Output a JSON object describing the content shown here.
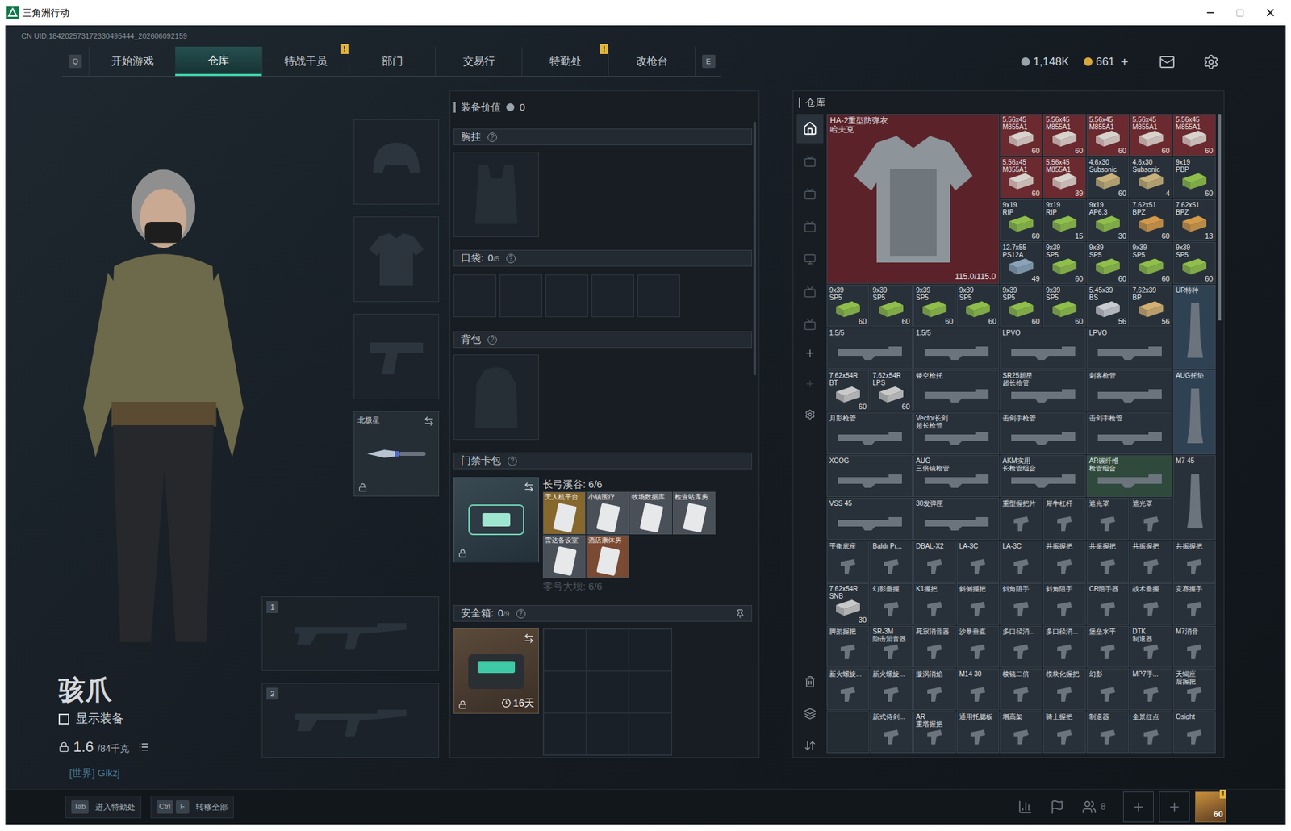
{
  "window": {
    "title": "三角洲行动",
    "uid": "CN UID:184202573172330495444_202606092159"
  },
  "nav": {
    "left_key": "Q",
    "right_key": "E",
    "tabs": [
      {
        "label": "开始游戏",
        "selected": false,
        "badge": ""
      },
      {
        "label": "仓库",
        "selected": true,
        "badge": ""
      },
      {
        "label": "特战干员",
        "selected": false,
        "badge": "!"
      },
      {
        "label": "部门",
        "selected": false,
        "badge": ""
      },
      {
        "label": "交易行",
        "selected": false,
        "badge": ""
      },
      {
        "label": "特勤处",
        "selected": false,
        "badge": "!"
      },
      {
        "label": "改枪台",
        "selected": false,
        "badge": ""
      }
    ],
    "currency": [
      {
        "value": "1,148K",
        "plus": "",
        "color": "#9aa3ab"
      },
      {
        "value": "661",
        "plus": "+",
        "color": "#d8a73a"
      }
    ]
  },
  "character": {
    "name": "骇爪",
    "show_equipment": {
      "label": "显示装备",
      "checked": false
    },
    "weight": "1.6",
    "capacity": "/84千克",
    "chat": "[世界] Gikzj"
  },
  "equipment_slots": [
    {
      "kind": "helmet",
      "label": "",
      "locked": false
    },
    {
      "kind": "armor",
      "label": "",
      "locked": false
    },
    {
      "kind": "pistol",
      "label": "",
      "locked": false
    },
    {
      "kind": "knife",
      "label": "北极星",
      "locked": true
    }
  ],
  "weapon_slots": [
    {
      "number": "1"
    },
    {
      "number": "2"
    }
  ],
  "loadout": {
    "value_label": "装备价值",
    "value": "0",
    "chest": {
      "label": "胸挂",
      "help": "?"
    },
    "pockets": {
      "label": "口袋:",
      "count": "0",
      "capacity": "/5",
      "help": "?",
      "slots": 5
    },
    "backpack": {
      "label": "背包",
      "help": "?"
    },
    "keycards": {
      "label": "门禁卡包",
      "help": "?",
      "locked": true,
      "maps": [
        {
          "name": "长弓溪谷: 6/6",
          "active": true,
          "cards": [
            {
              "name": "无人机平台",
              "color": "#86672c"
            },
            {
              "name": "小镇医疗",
              "color": "#4a5057"
            },
            {
              "name": "牧场数据库",
              "color": "#4a5057"
            },
            {
              "name": "检查站库房",
              "color": "#4a5057"
            },
            {
              "name": "雷达备设室",
              "color": "#4a5057"
            },
            {
              "name": "酒店康体房",
              "color": "#7a4a32"
            }
          ]
        },
        {
          "name": "零号大坝: 6/6",
          "active": false,
          "cards": []
        }
      ]
    },
    "safe": {
      "label": "安全箱:",
      "count": "0",
      "capacity": "/9",
      "help": "?",
      "timer": "16天",
      "locked": true,
      "cells": 9
    }
  },
  "warehouse": {
    "title": "仓库",
    "items": [
      {
        "name": "HA-2重型防弹衣\n哈夫克",
        "count": "115.0/115.0",
        "kind": "armor",
        "color": "#5b2329"
      },
      {
        "name": "5.56x45\nM855A1",
        "count": "60",
        "kind": "ammo",
        "color": "#6a2a2f",
        "box": "#d7d2cc"
      },
      {
        "name": "5.56x45\nM855A1",
        "count": "60",
        "kind": "ammo",
        "color": "#6a2a2f",
        "box": "#d7d2cc"
      },
      {
        "name": "5.56x45\nM855A1",
        "count": "60",
        "kind": "ammo",
        "color": "#6a2a2f",
        "box": "#d7d2cc"
      },
      {
        "name": "5.56x45\nM855A1",
        "count": "60",
        "kind": "ammo",
        "color": "#6a2a2f",
        "box": "#d7d2cc"
      },
      {
        "name": "5.56x45\nM855A1",
        "count": "60",
        "kind": "ammo",
        "color": "#6a2a2f",
        "box": "#d7d2cc"
      },
      {
        "name": "5.56x45\nM855A1",
        "count": "60",
        "kind": "ammo",
        "color": "#6a2a2f",
        "box": "#d7d2cc"
      },
      {
        "name": "5.56x45\nM855A1",
        "count": "39",
        "kind": "ammo",
        "color": "#6a2a2f",
        "box": "#d7d2cc"
      },
      {
        "name": "4.6x30\nSubsonic",
        "count": "60",
        "kind": "ammo",
        "color": "#28313a",
        "box": "#c8b27a"
      },
      {
        "name": "4.6x30\nSubsonic",
        "count": "4",
        "kind": "ammo",
        "color": "#28313a",
        "box": "#c8b27a"
      },
      {
        "name": "9x19\nPBP",
        "count": "60",
        "kind": "ammo",
        "color": "#28313a",
        "box": "#8fbf4a"
      },
      {
        "name": "9x19\nRIP",
        "count": "60",
        "kind": "ammo",
        "color": "#28313a",
        "box": "#8fbf4a"
      },
      {
        "name": "9x19\nRIP",
        "count": "15",
        "kind": "ammo",
        "color": "#28313a",
        "box": "#8fbf4a"
      },
      {
        "name": "9x19\nAP6.3",
        "count": "30",
        "kind": "ammo",
        "color": "#28313a",
        "box": "#8fbf4a"
      },
      {
        "name": "7.62x51\nBPZ",
        "count": "60",
        "kind": "ammo",
        "color": "#28313a",
        "box": "#d39a4a"
      },
      {
        "name": "7.62x51\nBPZ",
        "count": "13",
        "kind": "ammo",
        "color": "#28313a",
        "box": "#d39a4a"
      },
      {
        "name": "12.7x55\nPS12A",
        "count": "49",
        "kind": "ammo",
        "color": "#28313a",
        "box": "#8aa3b8"
      },
      {
        "name": "9x39\nSP5",
        "count": "60",
        "kind": "ammo",
        "color": "#28313a",
        "box": "#8fbf4a"
      },
      {
        "name": "9x39\nSP5",
        "count": "60",
        "kind": "ammo",
        "color": "#28313a",
        "box": "#8fbf4a"
      },
      {
        "name": "9x39\nSP5",
        "count": "60",
        "kind": "ammo",
        "color": "#28313a",
        "box": "#8fbf4a"
      },
      {
        "name": "9x39\nSP5",
        "count": "60",
        "kind": "ammo",
        "color": "#28313a",
        "box": "#8fbf4a"
      },
      {
        "name": "9x39\nSP5",
        "count": "60",
        "kind": "ammo",
        "color": "#28313a",
        "box": "#8fbf4a"
      },
      {
        "name": "9x39\nSP5",
        "count": "60",
        "kind": "ammo",
        "color": "#28313a",
        "box": "#8fbf4a"
      },
      {
        "name": "9x39\nSP5",
        "count": "60",
        "kind": "ammo",
        "color": "#28313a",
        "box": "#8fbf4a"
      },
      {
        "name": "9x39\nSP5",
        "count": "60",
        "kind": "ammo",
        "color": "#28313a",
        "box": "#8fbf4a"
      },
      {
        "name": "9x39\nSP5",
        "count": "60",
        "kind": "ammo",
        "color": "#28313a",
        "box": "#8fbf4a"
      },
      {
        "name": "9x39\nSP5",
        "count": "60",
        "kind": "ammo",
        "color": "#28313a",
        "box": "#8fbf4a"
      },
      {
        "name": "5.45x39\nBS",
        "count": "56",
        "kind": "ammo",
        "color": "#28313a",
        "box": "#c9ccd0"
      },
      {
        "name": "7.62x39\nBP",
        "count": "56",
        "kind": "ammo",
        "color": "#28313a",
        "box": "#d4b072"
      },
      {
        "name": "UR特种",
        "count": "",
        "kind": "tall",
        "color": "#2f4254"
      },
      {
        "name": "1.5/5",
        "count": "",
        "kind": "wide",
        "color": "#28313a"
      },
      {
        "name": "1.5/5",
        "count": "",
        "kind": "wide",
        "color": "#28313a"
      },
      {
        "name": "LPVO",
        "count": "",
        "kind": "wide",
        "color": "#28313a"
      },
      {
        "name": "LPVO",
        "count": "",
        "kind": "wide",
        "color": "#28313a"
      },
      {
        "name": "7.62x54R\nBT",
        "count": "60",
        "kind": "ammo",
        "color": "#28313a",
        "box": "#c8c8c8"
      },
      {
        "name": "7.62x54R\nLPS",
        "count": "60",
        "kind": "ammo",
        "color": "#28313a",
        "box": "#c8c8c8"
      },
      {
        "name": "镂空枪托",
        "count": "",
        "kind": "wide",
        "color": "#28313a"
      },
      {
        "name": "SR25新星\n超长枪管",
        "count": "",
        "kind": "wide",
        "color": "#28313a"
      },
      {
        "name": "刺客枪管",
        "count": "",
        "kind": "wide",
        "color": "#28313a"
      },
      {
        "name": "AUG托垫",
        "count": "",
        "kind": "tall",
        "color": "#2f4254"
      },
      {
        "name": "月影枪管",
        "count": "",
        "kind": "wide",
        "color": "#28313a"
      },
      {
        "name": "Vector长剑\n超长枪管",
        "count": "",
        "kind": "wide",
        "color": "#28313a"
      },
      {
        "name": "击剑手枪管",
        "count": "",
        "kind": "wide",
        "color": "#28313a"
      },
      {
        "name": "击剑手枪管",
        "count": "",
        "kind": "wide",
        "color": "#28313a"
      },
      {
        "name": "XCOG",
        "count": "",
        "kind": "wide",
        "color": "#28313a"
      },
      {
        "name": "AUG\n三倍镜枪管",
        "count": "",
        "kind": "wide",
        "color": "#28313a"
      },
      {
        "name": "AKM实用\n长枪管组合",
        "count": "",
        "kind": "wide",
        "color": "#28313a"
      },
      {
        "name": "AR碳纤维\n枪管组合",
        "count": "",
        "kind": "wide",
        "color": "#2f4a3c"
      },
      {
        "name": "M7 45",
        "count": "",
        "kind": "tall",
        "color": "#28313a"
      },
      {
        "name": "VSS 45",
        "count": "",
        "kind": "wide",
        "color": "#28313a"
      },
      {
        "name": "30发弹匣",
        "count": "",
        "kind": "wide",
        "color": "#28313a"
      },
      {
        "name": "重型握把片",
        "count": "",
        "kind": "item",
        "color": "#28313a"
      },
      {
        "name": "犀牛杠杆",
        "count": "",
        "kind": "item",
        "color": "#28313a"
      },
      {
        "name": "遮光罩",
        "count": "",
        "kind": "item",
        "color": "#28313a"
      },
      {
        "name": "遮光罩",
        "count": "",
        "kind": "item",
        "color": "#28313a"
      },
      {
        "name": "平衡底座",
        "count": "",
        "kind": "item",
        "color": "#28313a"
      },
      {
        "name": "Baldr Pr...",
        "count": "",
        "kind": "item",
        "color": "#28313a"
      },
      {
        "name": "DBAL-X2",
        "count": "",
        "kind": "item",
        "color": "#28313a"
      },
      {
        "name": "LA-3C",
        "count": "",
        "kind": "item",
        "color": "#28313a"
      },
      {
        "name": "LA-3C",
        "count": "",
        "kind": "item",
        "color": "#28313a"
      },
      {
        "name": "共振握把",
        "count": "",
        "kind": "item",
        "color": "#28313a"
      },
      {
        "name": "共振握把",
        "count": "",
        "kind": "item",
        "color": "#28313a"
      },
      {
        "name": "共振握把",
        "count": "",
        "kind": "item",
        "color": "#28313a"
      },
      {
        "name": "共振握把",
        "count": "",
        "kind": "item",
        "color": "#28313a"
      },
      {
        "name": "7.62x54R\nSNB",
        "count": "30",
        "kind": "ammo",
        "color": "#28313a",
        "box": "#c8c8c8"
      },
      {
        "name": "幻影垂握",
        "count": "",
        "kind": "item",
        "color": "#28313a"
      },
      {
        "name": "K1握把",
        "count": "",
        "kind": "item",
        "color": "#28313a"
      },
      {
        "name": "斜侧握把",
        "count": "",
        "kind": "item",
        "color": "#28313a"
      },
      {
        "name": "斜角阻手",
        "count": "",
        "kind": "item",
        "color": "#28313a"
      },
      {
        "name": "斜角阻手",
        "count": "",
        "kind": "item",
        "color": "#28313a"
      },
      {
        "name": "CR阻手器",
        "count": "",
        "kind": "item",
        "color": "#28313a"
      },
      {
        "name": "战术垂握",
        "count": "",
        "kind": "item",
        "color": "#28313a"
      },
      {
        "name": "竞赛握手",
        "count": "",
        "kind": "item",
        "color": "#28313a"
      },
      {
        "name": "脚架握把",
        "count": "",
        "kind": "item",
        "color": "#28313a"
      },
      {
        "name": "SR-3M\n隐击消音器",
        "count": "",
        "kind": "item",
        "color": "#28313a"
      },
      {
        "name": "死寂消音器",
        "count": "",
        "kind": "item",
        "color": "#28313a"
      },
      {
        "name": "沙暴垂直",
        "count": "",
        "kind": "item",
        "color": "#28313a"
      },
      {
        "name": "多口径消...",
        "count": "",
        "kind": "item",
        "color": "#28313a"
      },
      {
        "name": "多口径消...",
        "count": "",
        "kind": "item",
        "color": "#28313a"
      },
      {
        "name": "堡垒水平",
        "count": "",
        "kind": "item",
        "color": "#28313a"
      },
      {
        "name": "DTK\n制退器",
        "count": "",
        "kind": "item",
        "color": "#28313a"
      },
      {
        "name": "M7消音",
        "count": "",
        "kind": "item",
        "color": "#28313a"
      },
      {
        "name": "新火螺旋...",
        "count": "",
        "kind": "item",
        "color": "#28313a"
      },
      {
        "name": "新火螺旋...",
        "count": "",
        "kind": "item",
        "color": "#28313a"
      },
      {
        "name": "漩涡消焰",
        "count": "",
        "kind": "item",
        "color": "#28313a"
      },
      {
        "name": "M14 30",
        "count": "",
        "kind": "item",
        "color": "#28313a"
      },
      {
        "name": "棱镜二倍",
        "count": "",
        "kind": "item",
        "color": "#28313a"
      },
      {
        "name": "模块化握把",
        "count": "",
        "kind": "item",
        "color": "#28313a"
      },
      {
        "name": "幻影",
        "count": "",
        "kind": "item",
        "color": "#28313a"
      },
      {
        "name": "MP7手...",
        "count": "",
        "kind": "item",
        "color": "#28313a"
      },
      {
        "name": "天蝎座\n后握把",
        "count": "",
        "kind": "item",
        "color": "#28313a"
      },
      {
        "name": "",
        "count": "",
        "kind": "empty",
        "color": "#232b33"
      },
      {
        "name": "新式侍剑...",
        "count": "",
        "kind": "item",
        "color": "#28313a"
      },
      {
        "name": "AR\n重塔握把",
        "count": "",
        "kind": "item",
        "color": "#28313a"
      },
      {
        "name": "通用托腮板",
        "count": "",
        "kind": "item",
        "color": "#28313a"
      },
      {
        "name": "增高架",
        "count": "",
        "kind": "item",
        "color": "#28313a"
      },
      {
        "name": "骑士握把",
        "count": "",
        "kind": "item",
        "color": "#28313a"
      },
      {
        "name": "制退器",
        "count": "",
        "kind": "item",
        "color": "#28313a"
      },
      {
        "name": "全景红点",
        "count": "",
        "kind": "item",
        "color": "#28313a"
      },
      {
        "name": "Osight",
        "count": "",
        "kind": "item",
        "color": "#28313a"
      }
    ]
  },
  "bottom_bar": {
    "hints": [
      {
        "keys": [
          "Tab"
        ],
        "label": "进入特勤处"
      },
      {
        "keys": [
          "Ctrl",
          "F"
        ],
        "label": "转移全部"
      }
    ],
    "friends": "8",
    "level": "60",
    "level_badge": "!"
  }
}
